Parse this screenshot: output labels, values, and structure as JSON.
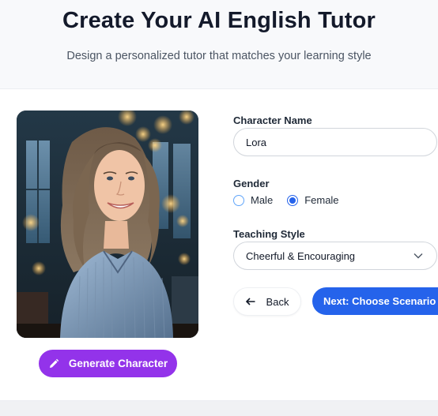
{
  "header": {
    "title": "Create Your AI English Tutor",
    "subtitle": "Design a personalized tutor that matches your learning style"
  },
  "character": {
    "portrait_icon": "ai-generated-woman-portrait",
    "generate_label": "Generate Character",
    "generate_icon": "pencil-icon"
  },
  "form": {
    "name_label": "Character Name",
    "name_value": "Lora",
    "gender_label": "Gender",
    "gender_options": [
      "Male",
      "Female"
    ],
    "gender_selected": "Female",
    "style_label": "Teaching Style",
    "style_value": "Cheerful & Encouraging"
  },
  "actions": {
    "back_label": "Back",
    "next_label": "Next: Choose Scenario"
  },
  "colors": {
    "purple": "#9333ea",
    "blue": "#2563eb"
  }
}
